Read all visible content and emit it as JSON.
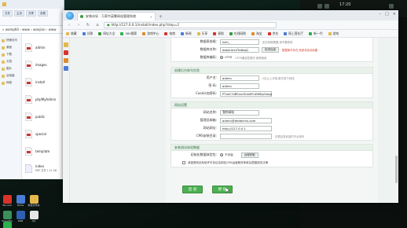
{
  "explorer": {
    "title": "",
    "ribbon": [
      "文件",
      "主页",
      "共享",
      "查看"
    ],
    "address": "« wamp64 › www › wanjian › www",
    "nav": [
      "快速访问",
      "桌面",
      "下载",
      "文档",
      "图片",
      "此电脑",
      "网络"
    ],
    "files": [
      {
        "name": "admin",
        "meta": ""
      },
      {
        "name": "images",
        "meta": ""
      },
      {
        "name": "install",
        "meta": ""
      },
      {
        "name": "phpMyAdmin",
        "meta": ""
      },
      {
        "name": "public",
        "meta": ""
      },
      {
        "name": "special",
        "meta": ""
      },
      {
        "name": "template",
        "meta": ""
      },
      {
        "name": "index",
        "meta": "PHP 文件 1.21 KB"
      }
    ]
  },
  "taskbar": {
    "icons": [
      {
        "label": "Tencent",
        "color": "#d9342b"
      },
      {
        "label": "Rufus",
        "color": "#4a7bd6"
      },
      {
        "label": "新建文件夹",
        "color": "#e5b84b"
      },
      {
        "label": "ShareFile",
        "color": "#3c8f5b"
      },
      {
        "label": "RGB",
        "color": "#2e5fb3"
      },
      {
        "label": "QQ",
        "color": "#e6e6e6"
      },
      {
        "label": "微信",
        "color": "#2bb24c"
      }
    ]
  },
  "tray": {
    "clock": "17:20"
  },
  "browser": {
    "tab_title": "安装向导 - 万家中英繁网站管理系统",
    "url": "http://127.0.0.1/install/index.php?step=2",
    "bookmarks": [
      "收藏",
      "谷歌",
      "网址大全",
      "360搜索",
      "游戏中心",
      "电商",
      "新闻",
      "乐享",
      "易购",
      "在线网购",
      "淘宝",
      "京东",
      "网上营业厅",
      "新一代",
      "游戏"
    ]
  },
  "form": {
    "db_section": {
      "rows": [
        {
          "label": "数据表前缀:",
          "value": "lizhi_",
          "hint": "如无特殊需要,请不要修改"
        },
        {
          "label": "数据库名称:",
          "value": "datacmsVTcdbqQ",
          "btn": "检测连接",
          "hint": "数据库不存在,系统将自动创建"
        },
        {
          "label": "数据库编码:",
          "radio": "UTF8",
          "hint": "UTF8兼容性更好,推荐使用"
        }
      ]
    },
    "admin_section": {
      "title": "创建后台账号信息",
      "rows": [
        {
          "label": "用户名:",
          "value": "admin",
          "hint": "2位以上字母,数字或下划线"
        },
        {
          "label": "密 码:",
          "value": "admin",
          "hint": ""
        },
        {
          "label": "Cookie加密码:",
          "value": "PTxkCOiBSuvrSUdHFuDMKpOeqp",
          "hint": ""
        }
      ]
    },
    "site_section": {
      "title": "网站设置",
      "rows": [
        {
          "label": "网站名称:",
          "value": "我的网站",
          "hint": ""
        },
        {
          "label": "管理员邮箱:",
          "value": "admin@dedecms.com",
          "hint": ""
        },
        {
          "label": "网站网址:",
          "value": "http://127.0.0.1",
          "hint": ""
        },
        {
          "label": "CMS安装目录:",
          "value": "",
          "hint": "在根目录安装时不必填写"
        }
      ]
    },
    "extra_section": {
      "title": "安装测试体验数据",
      "rows": [
        {
          "label": "初始化数据体验包:",
          "radio": "不安装",
          "btn": "远程获取"
        }
      ],
      "check_label": "我接受网站系统许可协议及网站CMS运营服务条款及遵循相关法律"
    },
    "buttons": {
      "back": "后 退",
      "next": "继 续"
    }
  }
}
